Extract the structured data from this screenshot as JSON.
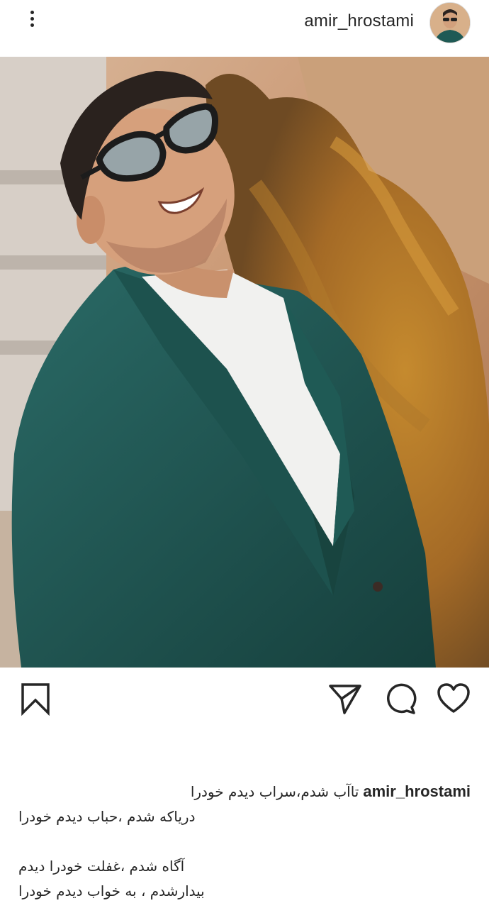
{
  "header": {
    "username": "amir_hrostami",
    "icons": {
      "more": "more-vertical-icon",
      "avatar": "profile-avatar"
    }
  },
  "post": {
    "image_alt": "man in teal suit and sunglasses smiling outdoors"
  },
  "actions": {
    "icons": [
      "bookmark-icon",
      "share-icon",
      "comment-icon",
      "like-icon"
    ]
  },
  "caption": {
    "username": "amir_hrostami",
    "lines": [
      "تاآب شدم،سراب دیدم خودرا",
      "دریاکه شدم ،حباب دیدم خودرا",
      "",
      "آگاه شدم ،غفلت خودرا دیدم",
      "بیدارشدم ، به خواب دیدم خودرا"
    ]
  },
  "colors": {
    "text": "#262626",
    "background": "#ffffff",
    "suit": "#1f5a55",
    "backdrop": "#c89a6d"
  }
}
